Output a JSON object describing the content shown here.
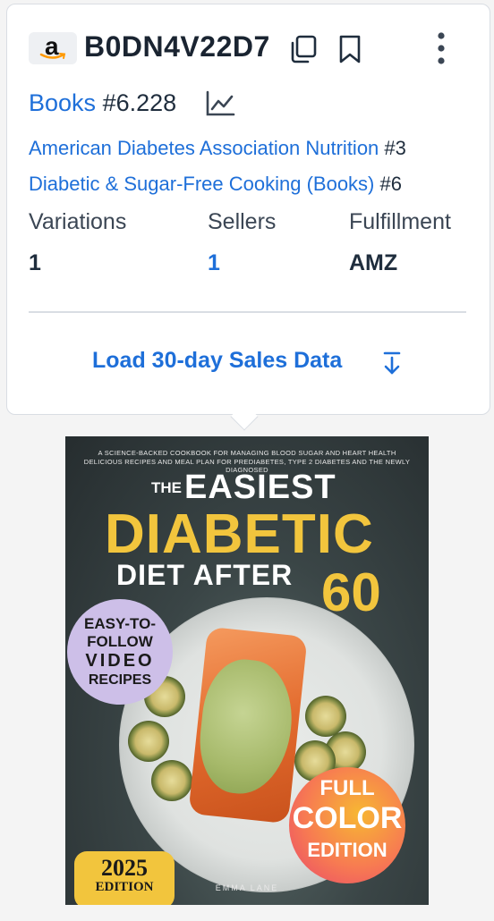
{
  "product": {
    "asin": "B0DN4V22D7",
    "logo_letter": "a",
    "icons": [
      "amazon-logo",
      "copy-icon",
      "bookmark-icon",
      "more-vertical-icon",
      "line-chart-icon",
      "download-arrow-icon"
    ]
  },
  "rank": {
    "category": "Books",
    "number": "#6.228",
    "subcategories": [
      {
        "name": "American Diabetes Association Nutrition",
        "rank": "#3"
      },
      {
        "name": "Diabetic & Sugar-Free Cooking (Books)",
        "rank": "#6"
      }
    ]
  },
  "stats": [
    {
      "label": "Variations",
      "value": "1"
    },
    {
      "label": "Sellers",
      "value": "1"
    },
    {
      "label": "Fulfillment",
      "value": "AMZ"
    }
  ],
  "actions": {
    "load_sales": "Load 30-day Sales Data"
  },
  "colors": {
    "link": "#1e6fd9",
    "text": "#1f2d3d",
    "border": "#d9dde3",
    "cover_yellow": "#f2c53d"
  },
  "cover": {
    "tagline1": "A SCIENCE-BACKED COOKBOOK FOR MANAGING BLOOD SUGAR AND HEART HEALTH",
    "tagline2": "DELICIOUS RECIPES AND MEAL PLAN FOR PREDIABETES, TYPE 2 DIABETES AND THE NEWLY DIAGNOSED",
    "the": "THE",
    "easiest": "EASIEST",
    "diabetic": "DIABETIC",
    "diet_after": "DIET AFTER",
    "sixty": "60",
    "video_badge": [
      "EASY-TO-",
      "FOLLOW",
      "VIDEO",
      "RECIPES"
    ],
    "color_badge": [
      "FULL",
      "COLOR",
      "EDITION"
    ],
    "year": "2025",
    "edition": "EDITION",
    "author": "EMMA LANE"
  }
}
